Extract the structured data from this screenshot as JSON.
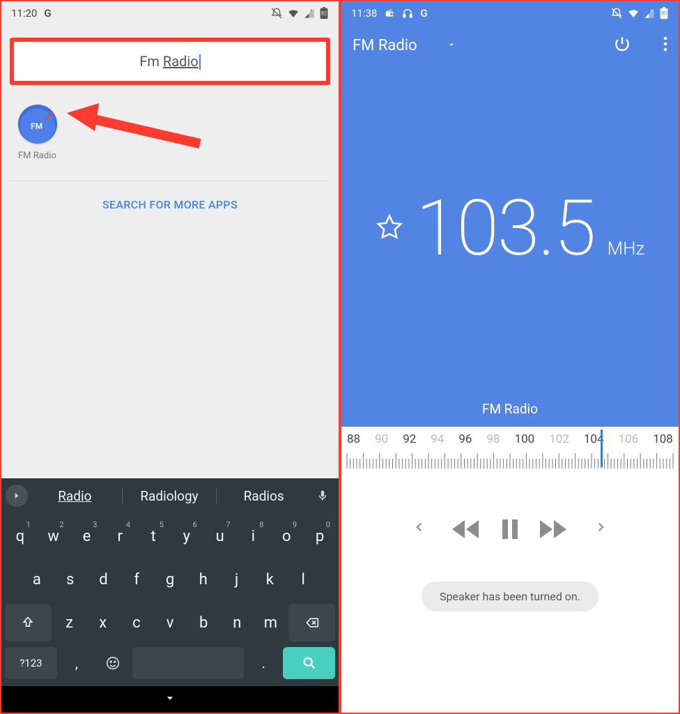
{
  "left": {
    "status": {
      "time": "11:20",
      "g": "G",
      "battery": "82"
    },
    "search": {
      "prefix": "Fm ",
      "underlined": "Radio"
    },
    "app_result": {
      "label": "FM Radio",
      "icon_text": "FM"
    },
    "more_apps": "SEARCH FOR MORE APPS",
    "keyboard": {
      "suggestions": [
        "Radio",
        "Radiology",
        "Radios"
      ],
      "row1": [
        "q",
        "w",
        "e",
        "r",
        "t",
        "y",
        "u",
        "i",
        "o",
        "p"
      ],
      "nums": [
        "1",
        "2",
        "3",
        "4",
        "5",
        "6",
        "7",
        "8",
        "9",
        "0"
      ],
      "row2": [
        "a",
        "s",
        "d",
        "f",
        "g",
        "h",
        "j",
        "k",
        "l"
      ],
      "row3": [
        "z",
        "x",
        "c",
        "v",
        "b",
        "n",
        "m"
      ],
      "sym": "?123",
      "comma": ",",
      "period": "."
    }
  },
  "right": {
    "status": {
      "time": "11:38",
      "battery": "80"
    },
    "appbar": {
      "title": "FM Radio"
    },
    "frequency": "103.5",
    "unit": "MHz",
    "station": "FM Radio",
    "dial": {
      "labels": [
        "88",
        "90",
        "92",
        "94",
        "96",
        "98",
        "100",
        "102",
        "104",
        "106",
        "108"
      ],
      "dim": [
        false,
        true,
        false,
        true,
        false,
        true,
        false,
        true,
        false,
        true,
        false
      ],
      "selected": 103.5
    },
    "toast": "Speaker has been turned on."
  }
}
